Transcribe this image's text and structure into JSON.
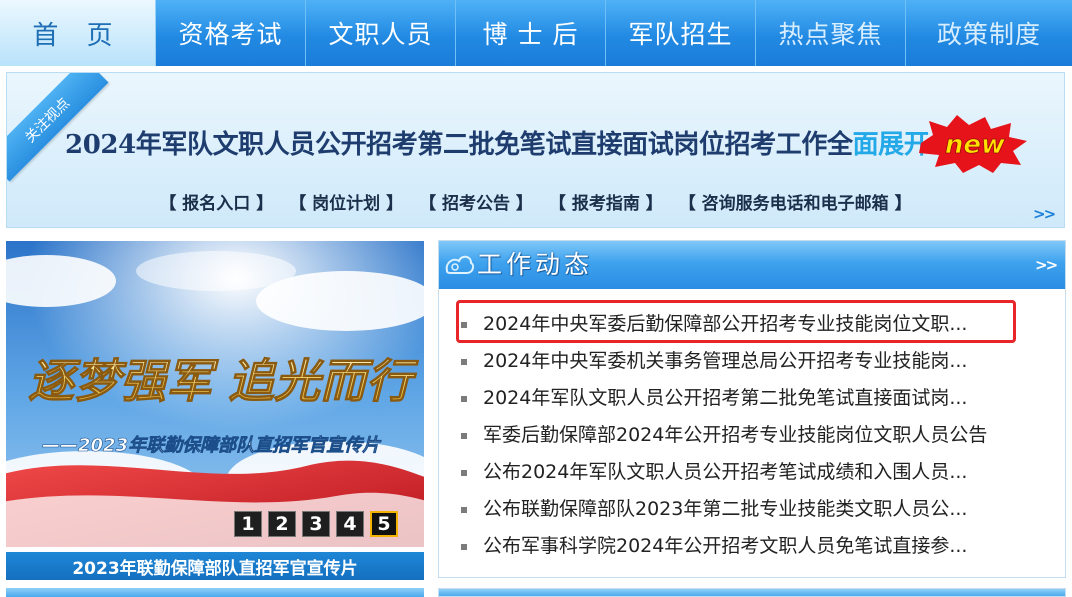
{
  "nav": {
    "items": [
      {
        "label": "首 页"
      },
      {
        "label": "资格考试"
      },
      {
        "label": "文职人员"
      },
      {
        "label": "博 士 后"
      },
      {
        "label": "军队招生"
      },
      {
        "label": "热点聚焦"
      },
      {
        "label": "政策制度"
      }
    ]
  },
  "focus": {
    "ribbon": "关注视点",
    "headline_main": "2024年军队文职人员公开招考第二批免笔试直接面试岗位招考工作全",
    "headline_highlight": "面展开",
    "badge": "new",
    "links": [
      "【  报名入口  】",
      "【  岗位计划  】",
      "【  招考公告  】",
      "【  报考指南  】",
      "【  咨询服务电话和电子邮箱  】"
    ],
    "more": ">>"
  },
  "slideshow": {
    "image_title": "逐梦强军  追光而行",
    "image_subtitle": "——2023年联勤保障部队直招军官宣传片",
    "pages": [
      "1",
      "2",
      "3",
      "4",
      "5"
    ],
    "current_page": "5",
    "caption": "2023年联勤保障部队直招军官宣传片"
  },
  "work_dynamics": {
    "title": "工作动态",
    "more": ">>",
    "items": [
      "2024年中央军委后勤保障部公开招考专业技能岗位文职...",
      "2024年中央军委机关事务管理总局公开招考专业技能岗...",
      "2024年军队文职人员公开招考第二批免笔试直接面试岗...",
      "军委后勤保障部2024年公开招考专业技能岗位文职人员公告",
      "公布2024年军队文职人员公开招考笔试成绩和入围人员...",
      "公布联勤保障部队2023年第二批专业技能类文职人员公...",
      "公布军事科学院2024年公开招考文职人员免笔试直接参..."
    ]
  },
  "colors": {
    "nav_blue": "#228ae3",
    "highlight_red": "#e8262a",
    "headline_navy": "#1e3d6e",
    "accent_cyan": "#23a8e8"
  }
}
